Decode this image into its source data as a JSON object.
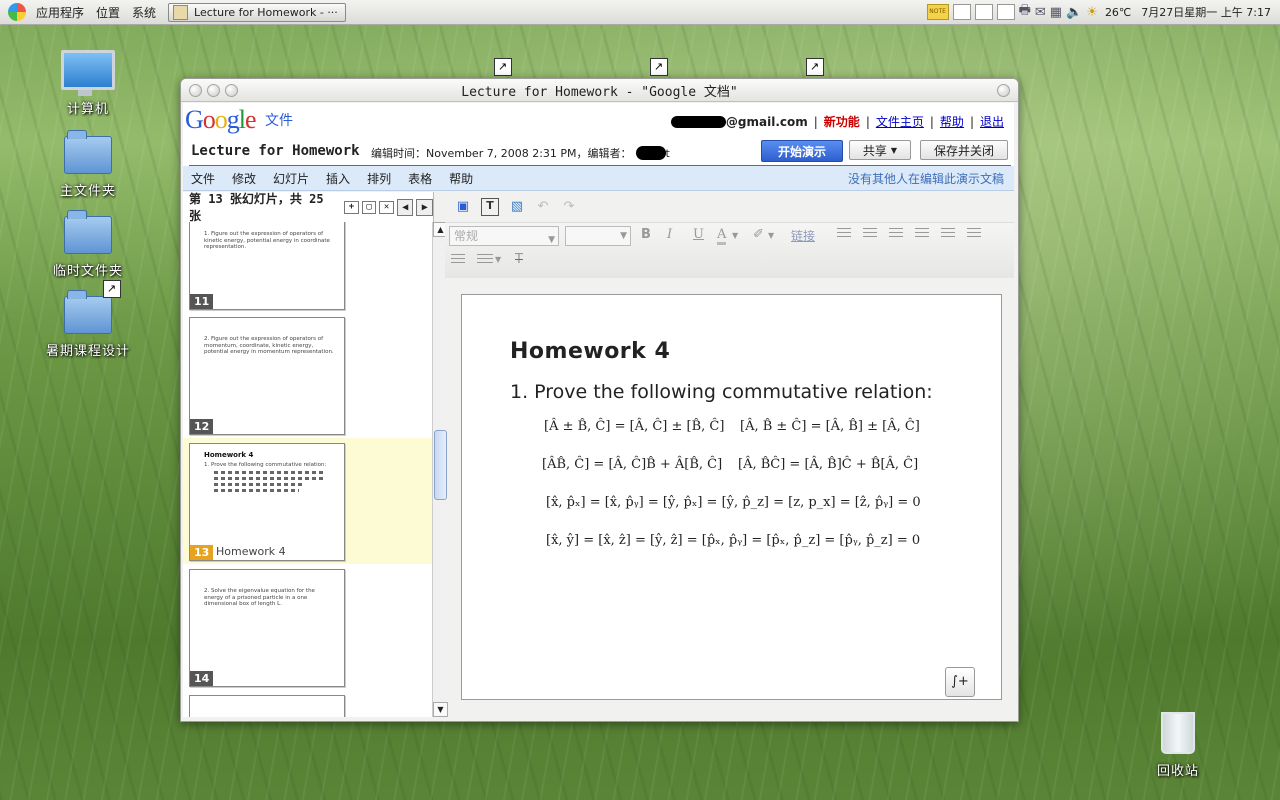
{
  "panel": {
    "menu": [
      "应用程序",
      "位置",
      "系统"
    ],
    "task_label": "Lecture for Homework - ···",
    "weather": "26℃",
    "clock": "7月27日星期一 上午 7:17",
    "note_label": "NOTE"
  },
  "desktop": {
    "icons": [
      {
        "label": "计算机"
      },
      {
        "label": "主文件夹"
      },
      {
        "label": "临时文件夹"
      },
      {
        "label": "暑期课程设计"
      }
    ],
    "trash_label": "回收站"
  },
  "window": {
    "title": "Lecture for Homework - \"Google 文档\""
  },
  "gdocs": {
    "logo": {
      "l1": "G",
      "l2": "o",
      "l3": "o",
      "l4": "g",
      "l5": "l",
      "l6": "e"
    },
    "logo_sub": "文件",
    "email_suffix": "@gmail.com",
    "links": {
      "new_features": "新功能",
      "home": "文件主页",
      "help": "帮助",
      "logout": "退出"
    },
    "doc_title": "Lecture for Homework",
    "doc_meta": "编辑时间：November 7, 2008 2:31 PM，编辑者：",
    "doc_meta_tail": "t",
    "buttons": {
      "present": "开始演示",
      "share": "共享",
      "save_close": "保存并关闭"
    }
  },
  "menubar": {
    "items": [
      "文件",
      "修改",
      "幻灯片",
      "插入",
      "排列",
      "表格",
      "帮助"
    ],
    "status": "没有其他人在编辑此演示文稿"
  },
  "sidebar": {
    "header": "第 13 张幻灯片，共 25 张",
    "slides": [
      {
        "num": "11",
        "text": "1. Figure out the expression of operators of kinetic energy, potential energy in coordinate representation."
      },
      {
        "num": "12",
        "text": "2. Figure out the expression of operators of momentum, coordinate, kinetic energy, potential energy in momentum representation."
      },
      {
        "num": "13",
        "title": "Homework 4",
        "text": "1. Prove the following commutative relation:",
        "caption": "Homework  4"
      },
      {
        "num": "14",
        "text": "2. Solve the eigenvalue equation for the energy of a prisoned particle in a one dimensional box of length L."
      }
    ]
  },
  "format": {
    "style_placeholder": "常规",
    "link_label": "链接"
  },
  "slide": {
    "title": "Homework 4",
    "item": "1. Prove the following commutative relation:",
    "equations": [
      "[Â ± B̂, Ĉ] = [Â, Ĉ] ± [B̂, Ĉ]",
      "[Â, B̂ ± Ĉ] = [Â, B̂] ± [Â, Ĉ]",
      "[ÂB̂, Ĉ] = [Â, Ĉ]B̂ + Â[B̂, Ĉ]",
      "[Â, B̂Ĉ] = [Â, B̂]Ĉ + B̂[Â, Ĉ]",
      "[x̂, p̂ₓ] = [x̂, p̂ᵧ] = [ŷ, p̂ₓ] = [ŷ, p̂_z] = [z, p_x] = [ẑ, p̂ᵧ] = 0",
      "[x̂, ŷ] = [x̂, ẑ] = [ŷ, ẑ] = [p̂ₓ, p̂ᵧ] = [p̂ₓ, p̂_z] = [p̂ᵧ, p̂_z] = 0"
    ]
  }
}
